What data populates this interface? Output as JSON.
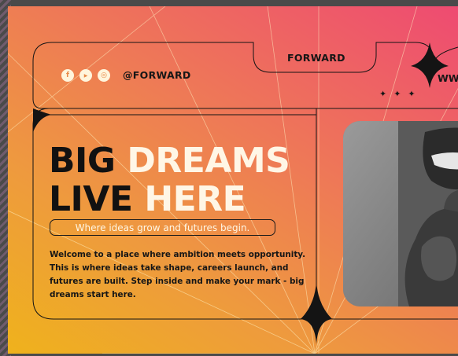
{
  "brand": {
    "handle": "@FORWARD",
    "tab_label": "FORWARD",
    "website_partial": "WW"
  },
  "social_icons": [
    {
      "name": "facebook-icon",
      "glyph": "f"
    },
    {
      "name": "youtube-icon",
      "glyph": "▶"
    },
    {
      "name": "instagram-icon",
      "glyph": "◎"
    }
  ],
  "sparkles": "✦✦✦",
  "headline": {
    "line1_dark": "BIG",
    "line1_light": "DREAMS",
    "line2_dark": "LIVE",
    "line2_light": "HERE"
  },
  "tagline": "Where ideas grow and futures begin.",
  "body": "Welcome to a place where ambition meets opportunity. This is where ideas take shape, careers launch, and futures are built. Step inside and make your mark - big dreams start here.",
  "colors": {
    "gradient_start": "#efb21c",
    "gradient_end": "#ee4a72",
    "ink": "#111111",
    "cream": "#fff6e6"
  },
  "image": {
    "description_icon": "photo-collage"
  }
}
